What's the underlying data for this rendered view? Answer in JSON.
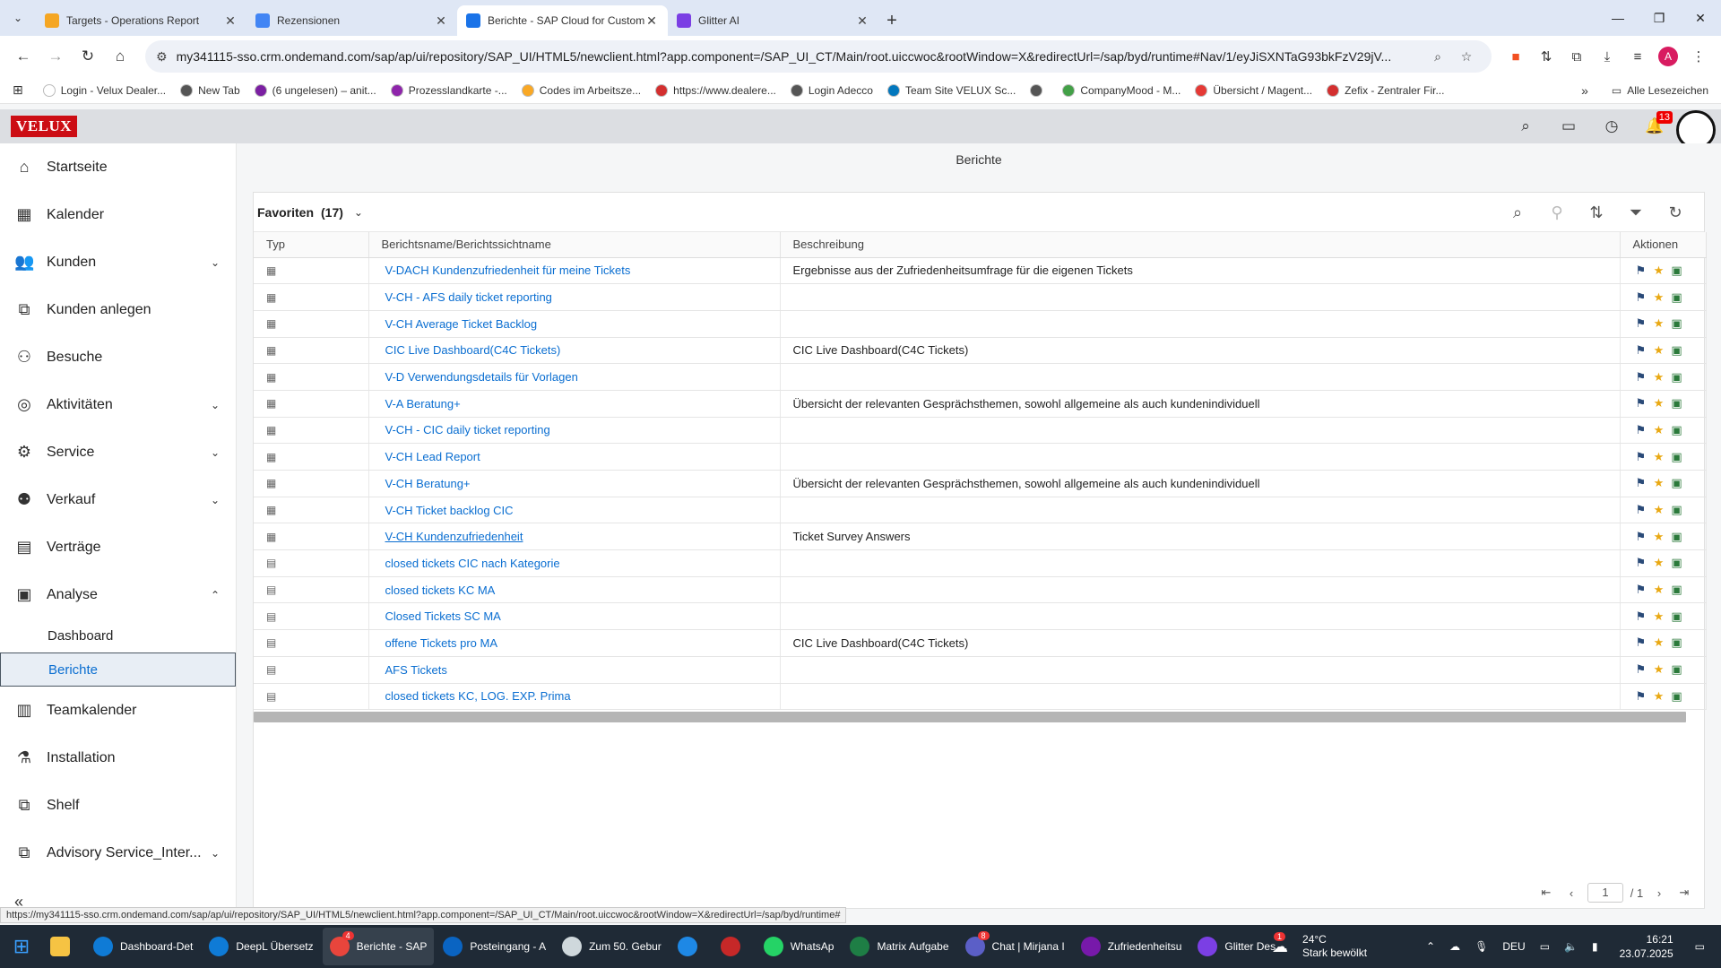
{
  "browser": {
    "tabs": [
      {
        "title": "Targets - Operations Report",
        "color": "#f5a623",
        "active": false
      },
      {
        "title": "Rezensionen",
        "color": "#4285f4",
        "active": false
      },
      {
        "title": "Berichte - SAP Cloud for Custom",
        "color": "#1a73e8",
        "active": true
      },
      {
        "title": "Glitter AI",
        "color": "#7b3fe4",
        "active": false
      }
    ],
    "url": "my341115-sso.crm.ondemand.com/sap/ap/ui/repository/SAP_UI/HTML5/newclient.html?app.component=/SAP_UI_CT/Main/root.uiccwoc&rootWindow=X&redirectUrl=/sap/byd/runtime#Nav/1/eyJiSXNTaG93bkFzV29jV...",
    "profile_initial": "A",
    "bookmarks": [
      {
        "label": "Login - Velux Dealer...",
        "color": "#ffffff"
      },
      {
        "label": "New Tab",
        "color": "#555555"
      },
      {
        "label": "(6 ungelesen) – anit...",
        "color": "#7b1fa2"
      },
      {
        "label": "Prozesslandkarte -...",
        "color": "#8e24aa"
      },
      {
        "label": "Codes im Arbeitsze...",
        "color": "#f9a825"
      },
      {
        "label": "https://www.dealere...",
        "color": "#d32f2f"
      },
      {
        "label": "Login Adecco",
        "color": "#555555"
      },
      {
        "label": "Team Site VELUX Sc...",
        "color": "#0277bd"
      },
      {
        "label": "",
        "color": "#555555"
      },
      {
        "label": "CompanyMood - M...",
        "color": "#43a047"
      },
      {
        "label": "Übersicht / Magent...",
        "color": "#e53935"
      },
      {
        "label": "Zefix - Zentraler Fir...",
        "color": "#d32f2f"
      }
    ],
    "bookmarks_more": "»",
    "all_bookmarks": "Alle Lesezeichen",
    "status_url": "https://my341115-sso.crm.ondemand.com/sap/ap/ui/repository/SAP_UI/HTML5/newclient.html?app.component=/SAP_UI_CT/Main/root.uiccwoc&rootWindow=X&redirectUrl=/sap/byd/runtime#"
  },
  "shell": {
    "logo": "VELUX",
    "notification_count": "13",
    "page_title": "Berichte"
  },
  "sidebar": {
    "items": [
      {
        "label": "Startseite",
        "icon": "⌂",
        "chevron": ""
      },
      {
        "label": "Kalender",
        "icon": "▦",
        "chevron": ""
      },
      {
        "label": "Kunden",
        "icon": "👥",
        "chevron": "⌄"
      },
      {
        "label": "Kunden anlegen",
        "icon": "⧉",
        "chevron": ""
      },
      {
        "label": "Besuche",
        "icon": "⚇",
        "chevron": ""
      },
      {
        "label": "Aktivitäten",
        "icon": "◎",
        "chevron": "⌄"
      },
      {
        "label": "Service",
        "icon": "⚙",
        "chevron": "⌄"
      },
      {
        "label": "Verkauf",
        "icon": "⚉",
        "chevron": "⌄"
      },
      {
        "label": "Verträge",
        "icon": "▤",
        "chevron": ""
      },
      {
        "label": "Analyse",
        "icon": "▣",
        "chevron": "⌃"
      }
    ],
    "sub_items": [
      {
        "label": "Dashboard",
        "selected": false
      },
      {
        "label": "Berichte",
        "selected": true
      }
    ],
    "items_after": [
      {
        "label": "Teamkalender",
        "icon": "▥",
        "chevron": ""
      },
      {
        "label": "Installation",
        "icon": "⚗",
        "chevron": ""
      },
      {
        "label": "Shelf",
        "icon": "⧉",
        "chevron": ""
      },
      {
        "label": "Advisory Service_Inter...",
        "icon": "⧉",
        "chevron": "⌄"
      }
    ],
    "collapse_icon": "«"
  },
  "panel": {
    "title": "Favoriten",
    "count": "(17)",
    "columns": [
      "Typ",
      "Berichtsname/Berichtssichtname",
      "Beschreibung",
      "Aktionen"
    ],
    "rows": [
      {
        "type": "chart",
        "name": "V-DACH Kundenzufriedenheit für meine Tickets",
        "desc": "Ergebnisse aus der Zufriedenheitsumfrage für die eigenen Tickets",
        "underline": false
      },
      {
        "type": "chart",
        "name": "V-CH - AFS daily ticket reporting",
        "desc": "",
        "underline": false
      },
      {
        "type": "chart",
        "name": "V-CH Average Ticket Backlog",
        "desc": "",
        "underline": false
      },
      {
        "type": "chart",
        "name": "CIC Live Dashboard(C4C Tickets)",
        "desc": "CIC Live Dashboard(C4C Tickets)",
        "underline": false
      },
      {
        "type": "chart",
        "name": "V-D Verwendungsdetails für Vorlagen",
        "desc": "",
        "underline": false
      },
      {
        "type": "chart",
        "name": "V-A Beratung+",
        "desc": "Übersicht der relevanten Gesprächsthemen, sowohl allgemeine als auch kundenindividuell",
        "underline": false
      },
      {
        "type": "chart",
        "name": "V-CH - CIC daily ticket reporting",
        "desc": "",
        "underline": false
      },
      {
        "type": "chart",
        "name": "V-CH Lead Report",
        "desc": "",
        "underline": false
      },
      {
        "type": "chart",
        "name": "V-CH Beratung+",
        "desc": "Übersicht der relevanten Gesprächsthemen, sowohl allgemeine als auch kundenindividuell",
        "underline": false
      },
      {
        "type": "chart",
        "name": "V-CH Ticket backlog CIC",
        "desc": "",
        "underline": false
      },
      {
        "type": "chart",
        "name": "V-CH Kundenzufriedenheit",
        "desc": "Ticket Survey Answers",
        "underline": true
      },
      {
        "type": "view",
        "name": "closed tickets CIC nach Kategorie",
        "desc": "",
        "underline": false
      },
      {
        "type": "view",
        "name": "closed tickets KC MA",
        "desc": "",
        "underline": false
      },
      {
        "type": "view",
        "name": "Closed Tickets SC MA",
        "desc": "",
        "underline": false
      },
      {
        "type": "view",
        "name": "offene Tickets pro MA",
        "desc": "CIC Live Dashboard(C4C Tickets)",
        "underline": false
      },
      {
        "type": "view",
        "name": "AFS Tickets",
        "desc": "",
        "underline": false
      },
      {
        "type": "view",
        "name": "closed tickets KC, LOG. EXP. Prima",
        "desc": "",
        "underline": false
      }
    ],
    "pager": {
      "page": "1",
      "total": "/ 1"
    }
  },
  "taskbar": {
    "apps": [
      {
        "label": "Dashboard-Det",
        "color": "#0f7bd6",
        "active": false,
        "badge": ""
      },
      {
        "label": "DeepL Übersetz",
        "color": "#0f7bd6",
        "active": false,
        "badge": ""
      },
      {
        "label": "Berichte - SAP",
        "color": "#e8453c",
        "active": true,
        "badge": "4"
      },
      {
        "label": "Posteingang - A",
        "color": "#0a64c2",
        "active": false,
        "badge": ""
      },
      {
        "label": "Zum 50. Gebur",
        "color": "#cfd8dc",
        "active": false,
        "badge": ""
      },
      {
        "label": "",
        "color": "#1e88e5",
        "active": false,
        "badge": ""
      },
      {
        "label": "",
        "color": "#c62828",
        "active": false,
        "badge": ""
      },
      {
        "label": "WhatsAp",
        "color": "#25d366",
        "active": false,
        "badge": ""
      },
      {
        "label": "Matrix Aufgabe",
        "color": "#1e7e45",
        "active": false,
        "badge": ""
      },
      {
        "label": "Chat | Mirjana I",
        "color": "#5b5fc7",
        "active": false,
        "badge": "8"
      },
      {
        "label": "Zufriedenheitsu",
        "color": "#7719aa",
        "active": false,
        "badge": ""
      },
      {
        "label": "Glitter Des",
        "color": "#7b3fe4",
        "active": false,
        "badge": ""
      }
    ],
    "weather_temp": "24°C",
    "weather_desc": "Stark bewölkt",
    "weather_badge": "1",
    "lang": "DEU",
    "time": "16:21",
    "date": "23.07.2025"
  }
}
